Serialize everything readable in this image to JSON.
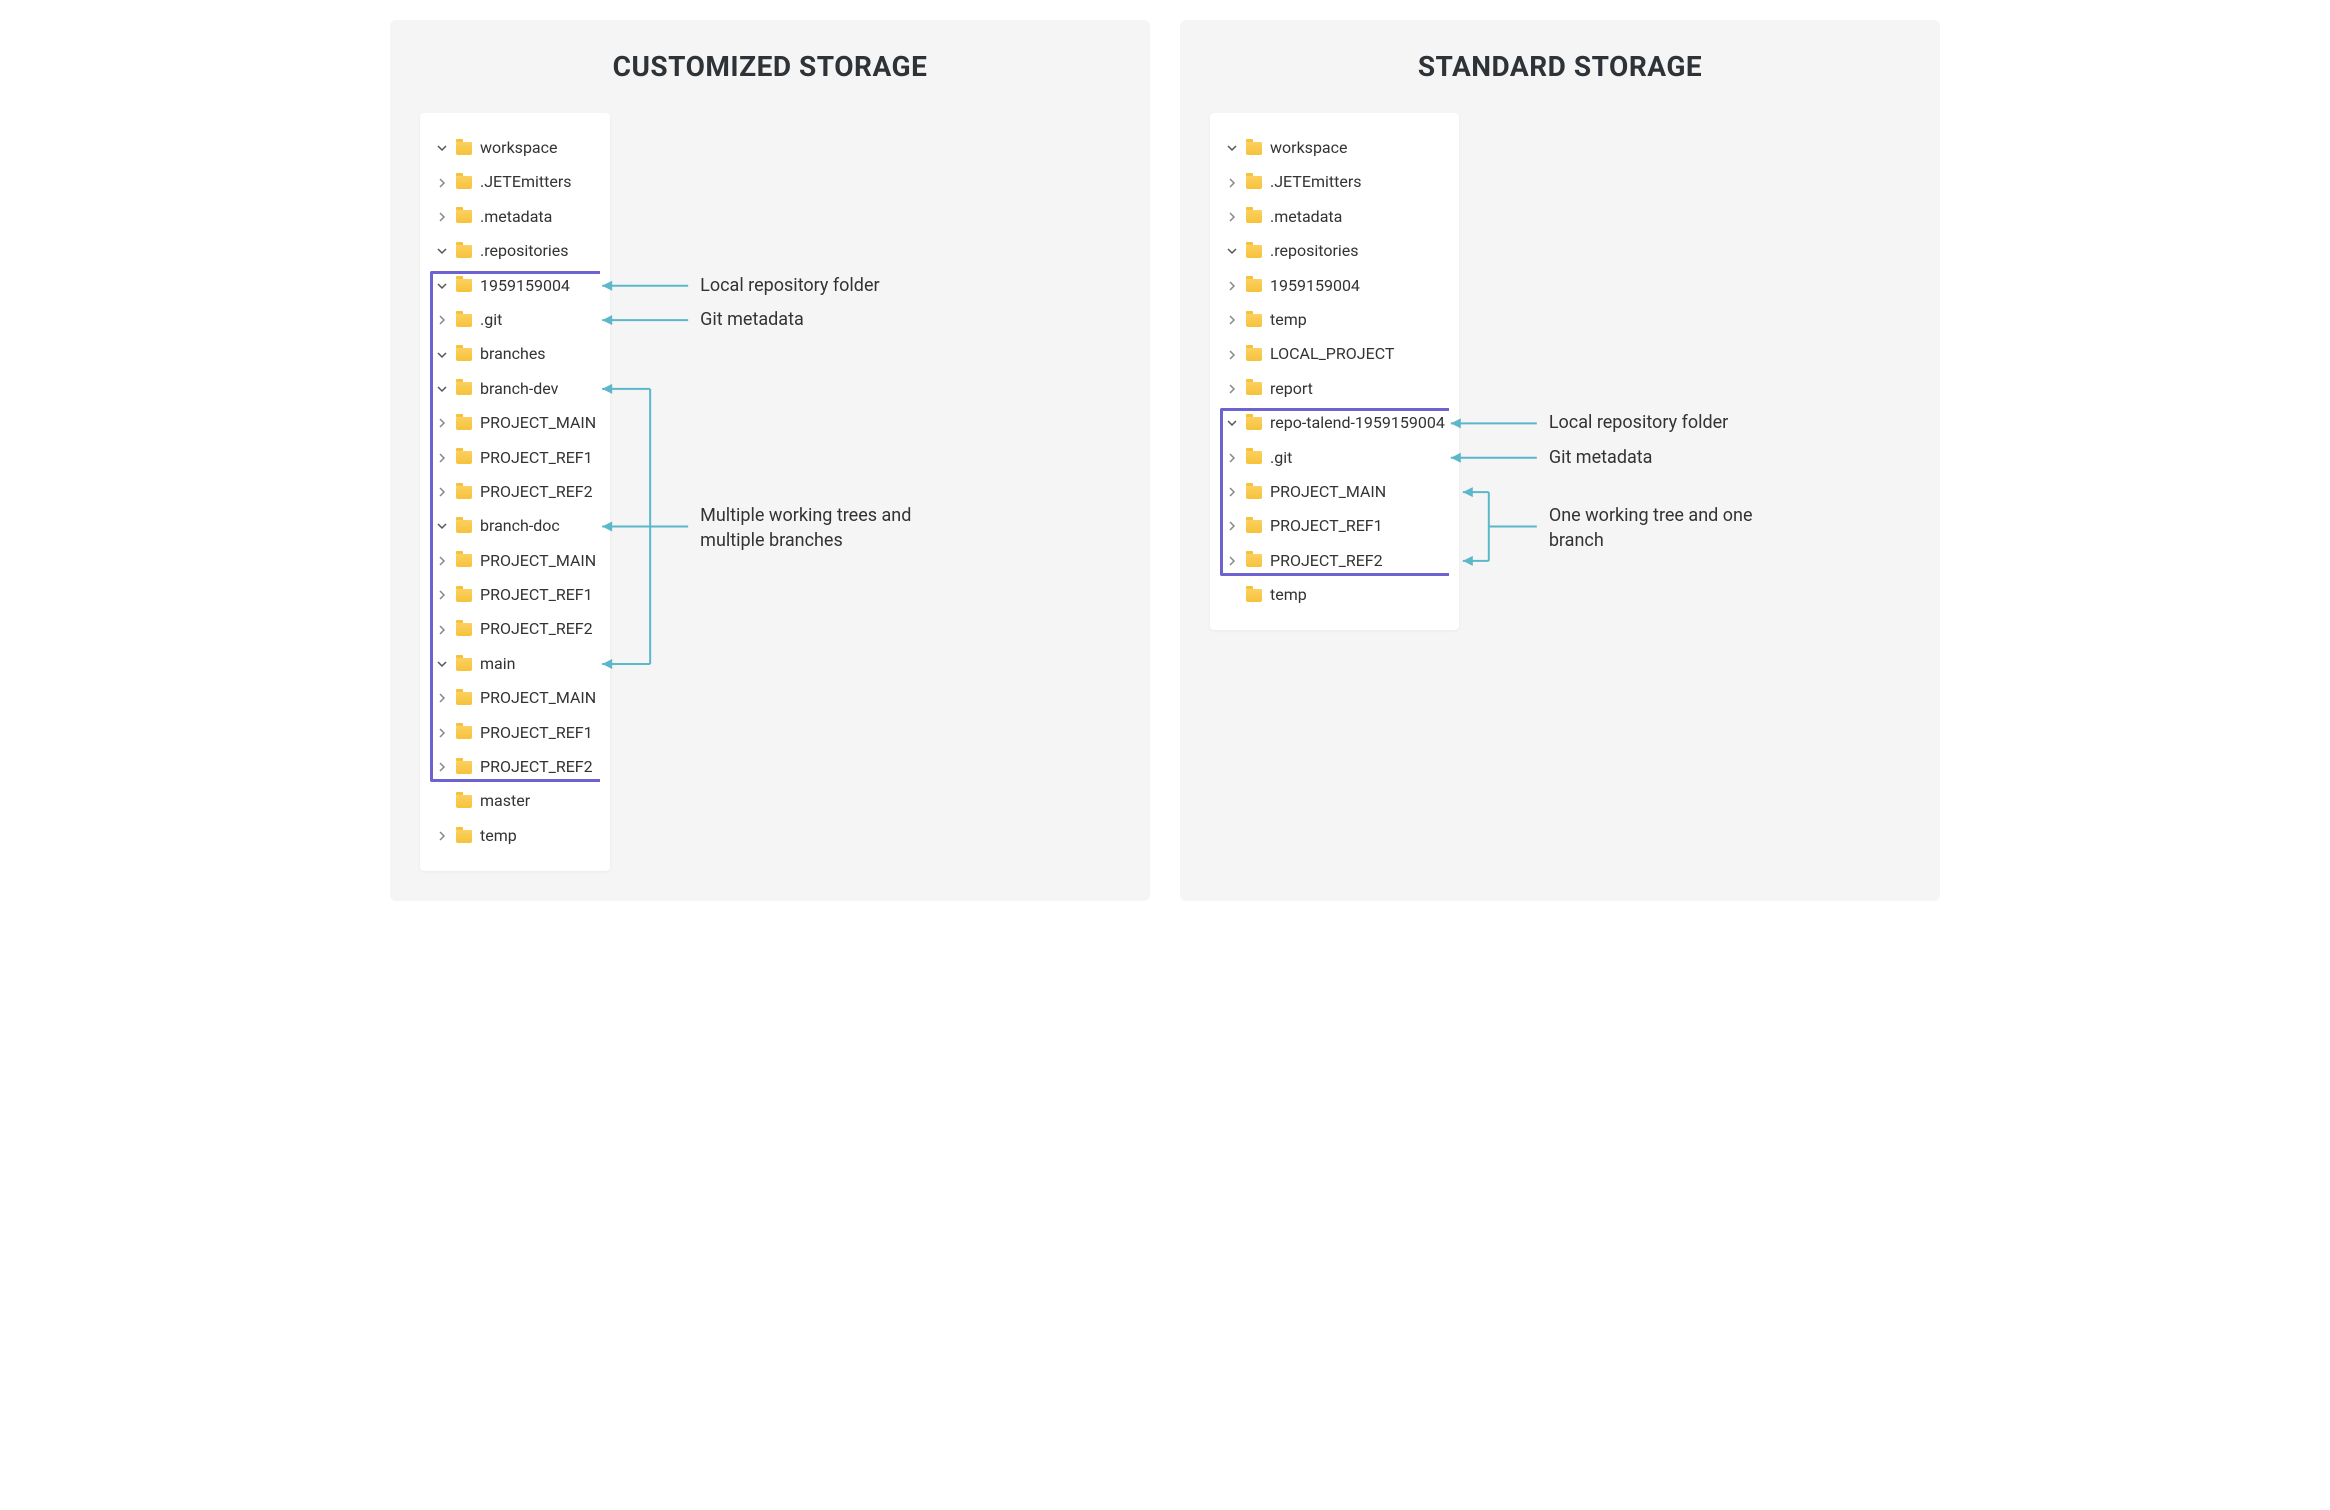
{
  "left": {
    "title": "CUSTOMIZED STORAGE",
    "tree": [
      {
        "indent": 0,
        "toggle": "down",
        "label": "workspace"
      },
      {
        "indent": 1,
        "toggle": "right",
        "label": ".JETEmitters"
      },
      {
        "indent": 1,
        "toggle": "right",
        "label": ".metadata"
      },
      {
        "indent": 1,
        "toggle": "down",
        "label": ".repositories"
      },
      {
        "indent": 2,
        "toggle": "down",
        "label": "1959159004"
      },
      {
        "indent": 3,
        "toggle": "right",
        "label": ".git"
      },
      {
        "indent": 3,
        "toggle": "down",
        "label": "branches"
      },
      {
        "indent": 4,
        "toggle": "down",
        "label": "branch-dev"
      },
      {
        "indent": 5,
        "toggle": "right",
        "label": "PROJECT_MAIN"
      },
      {
        "indent": 5,
        "toggle": "right",
        "label": "PROJECT_REF1"
      },
      {
        "indent": 5,
        "toggle": "right",
        "label": "PROJECT_REF2"
      },
      {
        "indent": 4,
        "toggle": "down",
        "label": "branch-doc"
      },
      {
        "indent": 5,
        "toggle": "right",
        "label": "PROJECT_MAIN"
      },
      {
        "indent": 5,
        "toggle": "right",
        "label": "PROJECT_REF1"
      },
      {
        "indent": 5,
        "toggle": "right",
        "label": "PROJECT_REF2"
      },
      {
        "indent": 4,
        "toggle": "down",
        "label": "main"
      },
      {
        "indent": 5,
        "toggle": "right",
        "label": "PROJECT_MAIN"
      },
      {
        "indent": 5,
        "toggle": "right",
        "label": "PROJECT_REF1"
      },
      {
        "indent": 5,
        "toggle": "right",
        "label": "PROJECT_REF2"
      },
      {
        "indent": 3,
        "toggle": "none",
        "label": "master"
      },
      {
        "indent": 1,
        "toggle": "right",
        "label": "temp"
      }
    ],
    "annotations": {
      "repo": "Local repository folder",
      "git": "Git metadata",
      "multi": "Multiple working trees and multiple branches"
    }
  },
  "right": {
    "title": "STANDARD STORAGE",
    "tree": [
      {
        "indent": 0,
        "toggle": "down",
        "label": "workspace"
      },
      {
        "indent": 1,
        "toggle": "right",
        "label": ".JETEmitters"
      },
      {
        "indent": 1,
        "toggle": "right",
        "label": ".metadata"
      },
      {
        "indent": 1,
        "toggle": "down",
        "label": ".repositories"
      },
      {
        "indent": 2,
        "toggle": "right",
        "label": "1959159004"
      },
      {
        "indent": 2,
        "toggle": "right",
        "label": "temp"
      },
      {
        "indent": 1,
        "toggle": "right",
        "label": "LOCAL_PROJECT"
      },
      {
        "indent": 1,
        "toggle": "right",
        "label": "report"
      },
      {
        "indent": 1,
        "toggle": "down",
        "label": "repo-talend-1959159004"
      },
      {
        "indent": 2,
        "toggle": "right",
        "label": ".git"
      },
      {
        "indent": 2,
        "toggle": "right",
        "label": "PROJECT_MAIN"
      },
      {
        "indent": 2,
        "toggle": "right",
        "label": "PROJECT_REF1"
      },
      {
        "indent": 2,
        "toggle": "right",
        "label": "PROJECT_REF2"
      },
      {
        "indent": 1,
        "toggle": "none",
        "label": "temp"
      }
    ],
    "annotations": {
      "repo": "Local repository folder",
      "git": "Git metadata",
      "one": "One working tree and one branch"
    }
  },
  "colors": {
    "arrow": "#5bb7c9",
    "bracket": "#6c63d1"
  }
}
